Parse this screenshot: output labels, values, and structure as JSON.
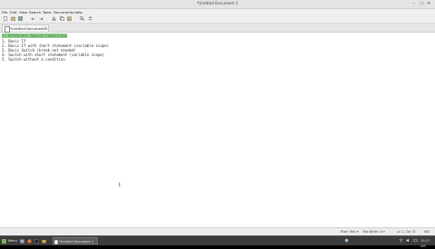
{
  "window": {
    "title": "*Untitled Document 1",
    "minimize_glyph": "–",
    "maximize_glyph": "▭",
    "close_glyph": "✕"
  },
  "menu": [
    "File",
    "Edit",
    "View",
    "Search",
    "Tools",
    "Documents",
    "Help"
  ],
  "toolbar_icons": [
    "new-file-icon",
    "open-file-icon",
    "save-icon",
    "undo-icon",
    "redo-icon",
    "cut-icon",
    "copy-icon",
    "paste-icon",
    "search-icon",
    "replace-icon"
  ],
  "tab": {
    "label": "*Untitled Document 1",
    "close": "✕"
  },
  "editor": {
    "lines": [
      "// Different Switch Conditions",
      "1. Basic If",
      "2. Basic If with short statement (variable scope)",
      "3. Basic Switch (break not needed)",
      "4. Switch with short statement (variable scope)",
      "5. Switch without a condition"
    ],
    "mouse_cursor": "I"
  },
  "status": {
    "language": "Plain Text ▾",
    "tab_width": "Tab Width: 8 ▾",
    "position": "Ln 1, Col 31",
    "mode": "INS"
  },
  "taskbar": {
    "menu_label": "Menu",
    "task_label": "*Untitled Document 1",
    "clock": "10:27 AM"
  }
}
